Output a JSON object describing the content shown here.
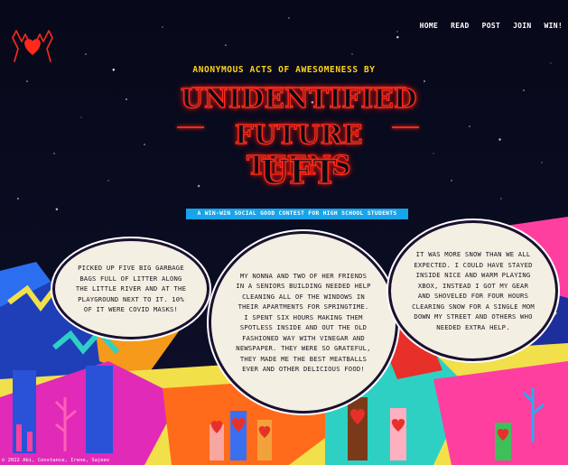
{
  "nav": {
    "items": [
      {
        "label": "HOME"
      },
      {
        "label": "READ"
      },
      {
        "label": "POST"
      },
      {
        "label": "JOIN"
      },
      {
        "label": "WIN!"
      }
    ]
  },
  "hero": {
    "kicker": "ANONYMOUS ACTS OF AWESOMENESS BY",
    "title_line1": "UNIDENTIFIED",
    "title_line2": "FUTURE TEENS",
    "title_line3": "UFT",
    "tagline": "A WIN-WIN SOCIAL GOOD CONTEST FOR HIGH SCHOOL STUDENTS"
  },
  "stories": [
    {
      "text": "PICKED UP FIVE BIG GARBAGE BAGS FULL OF LITTER ALONG THE LITTLE RIVER AND AT THE PLAYGROUND NEXT TO IT. 10% OF IT WERE COVID MASKS!"
    },
    {
      "text": "MY NONNA AND TWO OF HER FRIENDS IN A SENIORS BUILDING NEEDED HELP CLEANING ALL OF THE WINDOWS IN THEIR APARTMENTS FOR SPRINGTIME. I SPENT SIX HOURS MAKING THEM SPOTLESS INSIDE AND OUT THE OLD FASHIONED WAY WITH VINEGAR AND NEWSPAPER. THEY WERE SO GRATEFUL, THEY MADE ME THE BEST MEATBALLS EVER AND OTHER DELICIOUS FOOD!"
    },
    {
      "text": "IT WAS MORE SNOW THAN WE ALL EXPECTED. I COULD HAVE STAYED INSIDE NICE AND WARM PLAYING XBOX, INSTEAD I GOT MY GEAR AND SHOVELED FOR FOUR HOURS CLEARING SNOW FOR A SINGLE MOM DOWN MY STREET AND OTHERS WHO NEEDED EXTRA HELP."
    }
  ],
  "footer": {
    "text": "© 2022 Abi, Constance, Irene, Sajeev"
  },
  "colors": {
    "neon_red": "#ff2a1a",
    "kicker_yellow": "#ffd31a",
    "tagline_blue": "#17a4ea"
  },
  "icons": {
    "logo": "hands-heart-icon"
  }
}
